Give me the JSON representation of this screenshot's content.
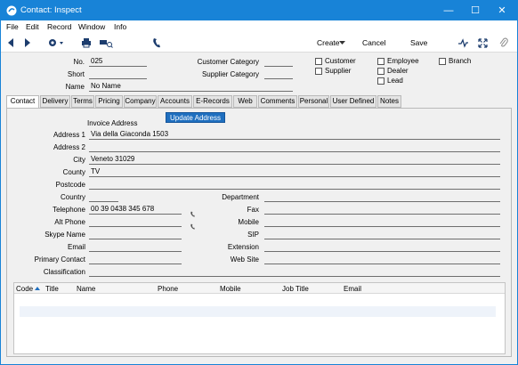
{
  "window": {
    "title": "Contact: Inspect",
    "minimize_label": "—",
    "maximize_label": "☐",
    "close_label": "✕"
  },
  "menu": [
    "File",
    "Edit",
    "Record",
    "Window",
    "Info"
  ],
  "toolbar": {
    "create_label": "Create",
    "cancel_label": "Cancel",
    "save_label": "Save"
  },
  "header": {
    "no_label": "No.",
    "no_value": "025",
    "short_label": "Short",
    "short_value": "",
    "name_label": "Name",
    "name_value": "No Name",
    "customer_category_label": "Customer Category",
    "customer_category_value": "",
    "supplier_category_label": "Supplier Category",
    "supplier_category_value": "",
    "checkboxes": {
      "customer": "Customer",
      "supplier": "Supplier",
      "employee": "Employee",
      "dealer": "Dealer",
      "lead": "Lead",
      "branch": "Branch"
    }
  },
  "tabs": [
    "Contact",
    "Delivery",
    "Terms",
    "Pricing",
    "Company",
    "Accounts",
    "E-Records",
    "Web",
    "Comments",
    "Personal",
    "User Defined",
    "Notes"
  ],
  "active_tab": "Contact",
  "contact": {
    "invoice_address_label": "Invoice Address",
    "update_address_label": "Update Address",
    "address1_label": "Address 1",
    "address1_value": "Via della Giaconda 1503",
    "address2_label": "Address 2",
    "address2_value": "",
    "city_label": "City",
    "city_value": "Veneto 31029",
    "county_label": "County",
    "county_value": "TV",
    "postcode_label": "Postcode",
    "postcode_value": "",
    "country_label": "Country",
    "country_value": "",
    "telephone_label": "Telephone",
    "telephone_value": "00 39 0438 345 678",
    "altphone_label": "Alt Phone",
    "altphone_value": "",
    "skype_label": "Skype Name",
    "skype_value": "",
    "email_label": "Email",
    "email_value": "",
    "primary_contact_label": "Primary Contact",
    "primary_contact_value": "",
    "classification_label": "Classification",
    "classification_value": "",
    "department_label": "Department",
    "fax_label": "Fax",
    "mobile_label": "Mobile",
    "sip_label": "SIP",
    "extension_label": "Extension",
    "website_label": "Web Site"
  },
  "grid": {
    "columns": [
      "Code",
      "Title",
      "Name",
      "Phone",
      "Mobile",
      "Job Title",
      "Email"
    ]
  }
}
